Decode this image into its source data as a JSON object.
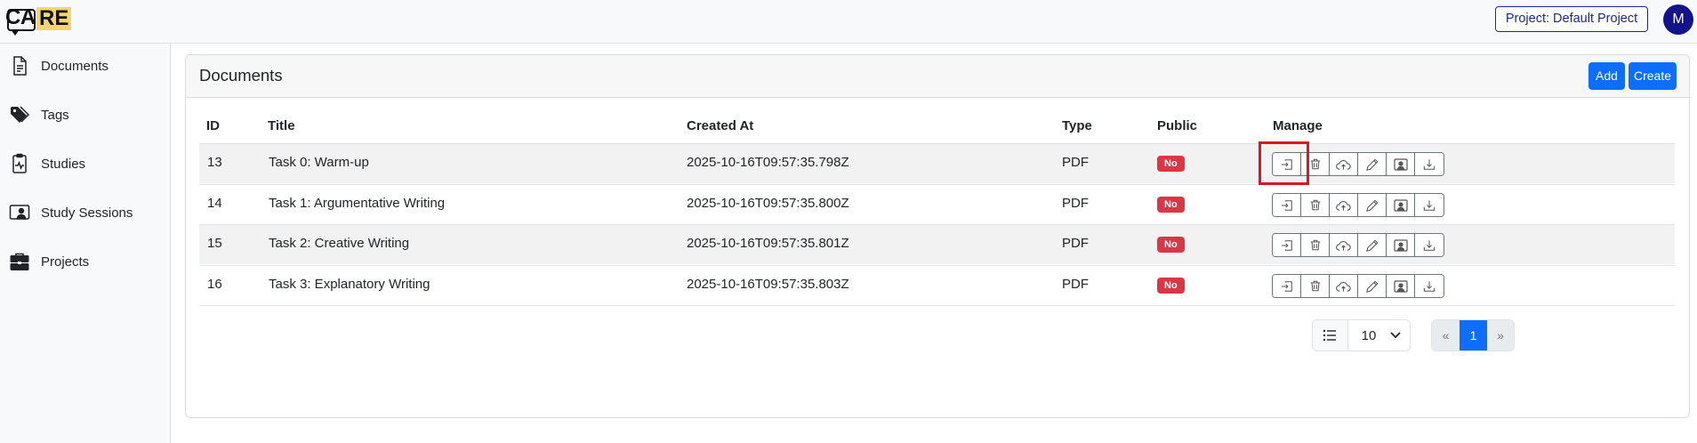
{
  "header": {
    "logo": "CARE",
    "project_label": "Project: Default Project",
    "avatar_initial": "M"
  },
  "sidebar": {
    "items": [
      {
        "label": "Documents",
        "icon": "document-icon"
      },
      {
        "label": "Tags",
        "icon": "tags-icon"
      },
      {
        "label": "Studies",
        "icon": "clipboard-pulse-icon"
      },
      {
        "label": "Study Sessions",
        "icon": "person-video-icon"
      },
      {
        "label": "Projects",
        "icon": "briefcase-icon"
      }
    ]
  },
  "card": {
    "title": "Documents",
    "add_label": "Add",
    "create_label": "Create"
  },
  "table": {
    "columns": [
      "ID",
      "Title",
      "Created At",
      "Type",
      "Public",
      "Manage"
    ],
    "rows": [
      {
        "id": "13",
        "title": "Task 0: Warm-up",
        "created_at": "2025-10-16T09:57:35.798Z",
        "type": "PDF",
        "public": "No"
      },
      {
        "id": "14",
        "title": "Task 1: Argumentative Writing",
        "created_at": "2025-10-16T09:57:35.800Z",
        "type": "PDF",
        "public": "No"
      },
      {
        "id": "15",
        "title": "Task 2: Creative Writing",
        "created_at": "2025-10-16T09:57:35.801Z",
        "type": "PDF",
        "public": "No"
      },
      {
        "id": "16",
        "title": "Task 3: Explanatory Writing",
        "created_at": "2025-10-16T09:57:35.803Z",
        "type": "PDF",
        "public": "No"
      }
    ],
    "manage_icons": [
      "open-icon",
      "trash-icon",
      "cloud-upload-icon",
      "pencil-icon",
      "person-badge-icon",
      "download-icon"
    ]
  },
  "pagination": {
    "page_size": "10",
    "prev": "«",
    "current_page": "1",
    "next": "»"
  },
  "colors": {
    "primary": "#0d6efd",
    "danger": "#dc3545",
    "highlight": "#e0141c",
    "avatar": "#14148a"
  }
}
